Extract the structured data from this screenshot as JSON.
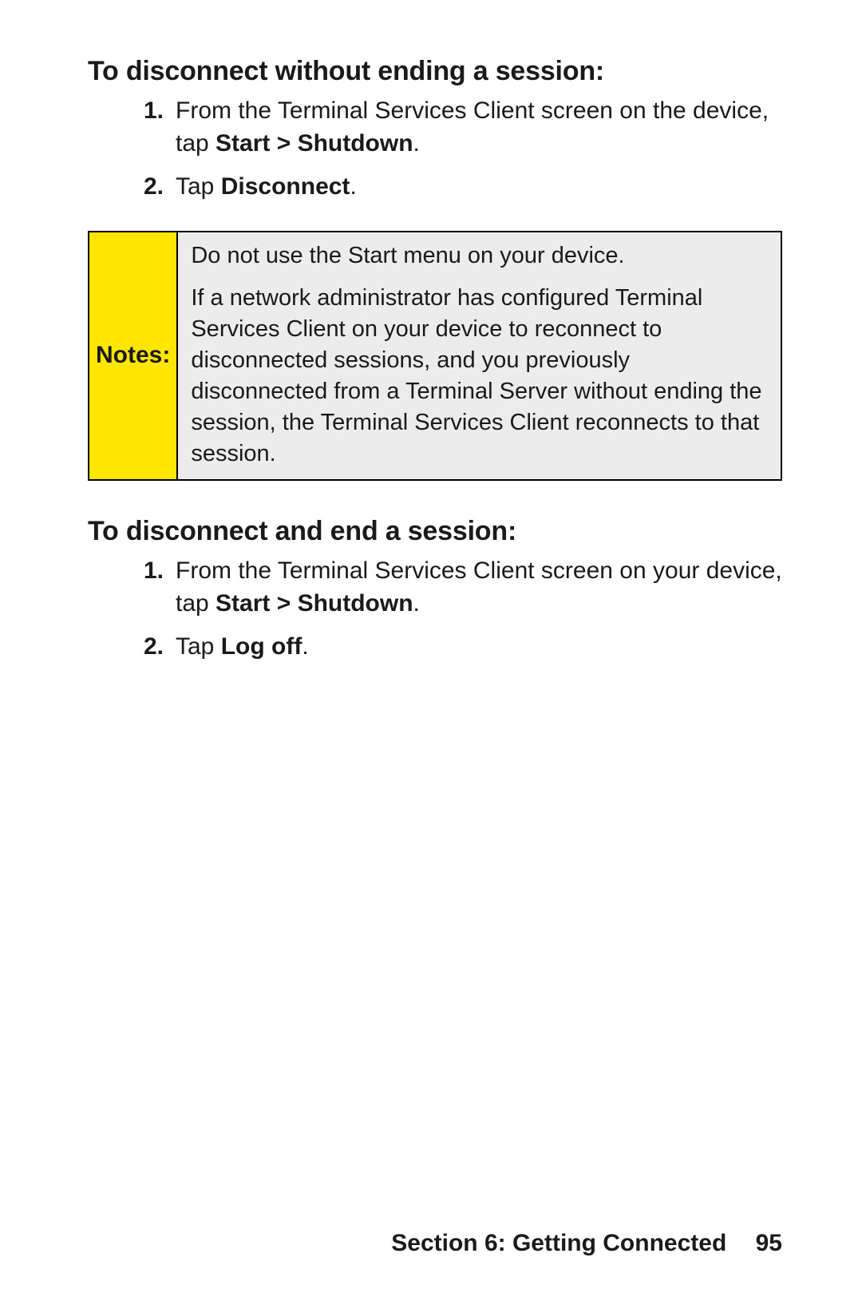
{
  "section1": {
    "heading": "To disconnect without ending a session:",
    "steps": [
      {
        "num": "1.",
        "pre": "From the Terminal Services Client screen on the device, tap ",
        "bold": "Start > Shutdown",
        "post": "."
      },
      {
        "num": "2.",
        "pre": "Tap ",
        "bold": "Disconnect",
        "post": "."
      }
    ]
  },
  "notes": {
    "label": "Notes:",
    "p1": "Do not use the Start menu on your device.",
    "p2": "If a network administrator has configured Terminal Services Client on your device to reconnect to disconnected sessions, and you previously disconnected from a Terminal Server without ending the session, the Terminal Services Client reconnects to that session."
  },
  "section2": {
    "heading": "To disconnect and end a session:",
    "steps": [
      {
        "num": "1.",
        "pre": "From the Terminal Services Client screen on your device, tap ",
        "bold": "Start > Shutdown",
        "post": "."
      },
      {
        "num": "2.",
        "pre": "Tap ",
        "bold": "Log off",
        "post": "."
      }
    ]
  },
  "footer": {
    "section": "Section 6: Getting Connected",
    "page": "95"
  }
}
